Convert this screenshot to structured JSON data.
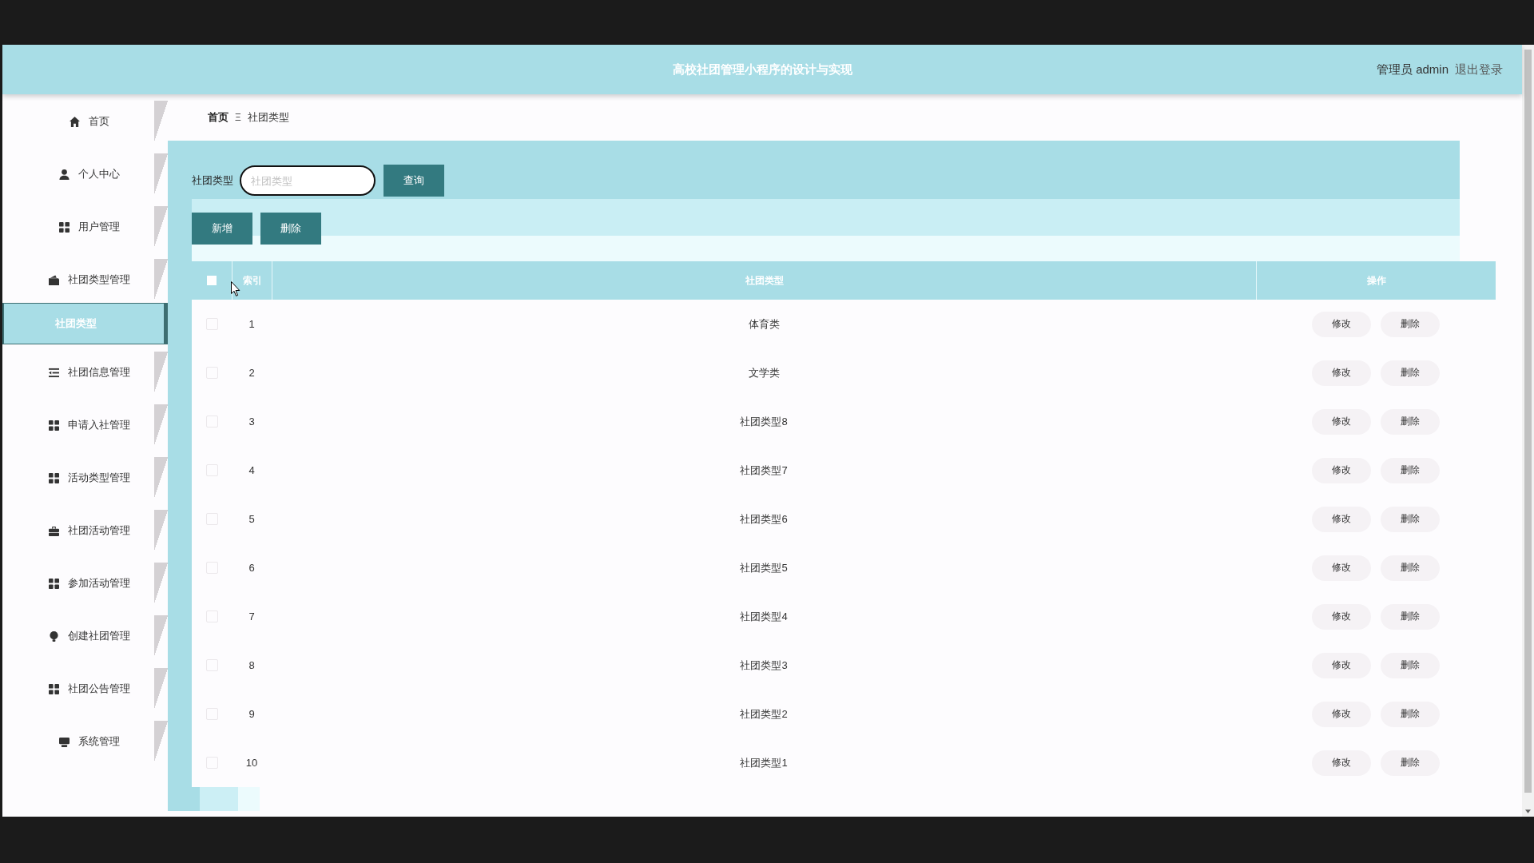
{
  "header": {
    "title": "高校社团管理小程序的设计与实现",
    "user": "管理员 admin",
    "logout": "退出登录"
  },
  "sidebar": {
    "items": [
      {
        "label": "首页",
        "selected": false
      },
      {
        "label": "个人中心",
        "selected": false
      },
      {
        "label": "用户管理",
        "selected": false
      },
      {
        "label": "社团类型管理",
        "selected": false,
        "children": [
          {
            "label": "社团类型",
            "selected": true
          }
        ]
      },
      {
        "label": "社团信息管理",
        "selected": false
      },
      {
        "label": "申请入社管理",
        "selected": false
      },
      {
        "label": "活动类型管理",
        "selected": false
      },
      {
        "label": "社团活动管理",
        "selected": false
      },
      {
        "label": "参加活动管理",
        "selected": false
      },
      {
        "label": "创建社团管理",
        "selected": false
      },
      {
        "label": "社团公告管理",
        "selected": false
      },
      {
        "label": "系统管理",
        "selected": false
      }
    ]
  },
  "breadcrumb": {
    "items": [
      "首页",
      "社团类型"
    ],
    "separator": "Ξ"
  },
  "search": {
    "label": "社团类型",
    "placeholder": "社团类型",
    "button": "查询"
  },
  "actions": [
    "新增",
    "删除"
  ],
  "table": {
    "all_checked": false,
    "columns": [
      "索引",
      "社团类型",
      "操作"
    ],
    "rows": [
      {
        "index": "1",
        "type": "体育类",
        "selected": false,
        "actions": [
          "修改",
          "删除"
        ]
      },
      {
        "index": "2",
        "type": "文学类",
        "selected": false,
        "actions": [
          "修改",
          "删除"
        ]
      },
      {
        "index": "3",
        "type": "社团类型8",
        "selected": false,
        "actions": [
          "修改",
          "删除"
        ]
      },
      {
        "index": "4",
        "type": "社团类型7",
        "selected": false,
        "actions": [
          "修改",
          "删除"
        ]
      },
      {
        "index": "5",
        "type": "社团类型6",
        "selected": false,
        "actions": [
          "修改",
          "删除"
        ]
      },
      {
        "index": "6",
        "type": "社团类型5",
        "selected": false,
        "actions": [
          "修改",
          "删除"
        ]
      },
      {
        "index": "7",
        "type": "社团类型4",
        "selected": false,
        "actions": [
          "修改",
          "删除"
        ]
      },
      {
        "index": "8",
        "type": "社团类型3",
        "selected": false,
        "actions": [
          "修改",
          "删除"
        ]
      },
      {
        "index": "9",
        "type": "社团类型2",
        "selected": false,
        "actions": [
          "修改",
          "删除"
        ]
      },
      {
        "index": "10",
        "type": "社团类型1",
        "selected": false,
        "actions": [
          "修改",
          "删除"
        ]
      }
    ]
  }
}
